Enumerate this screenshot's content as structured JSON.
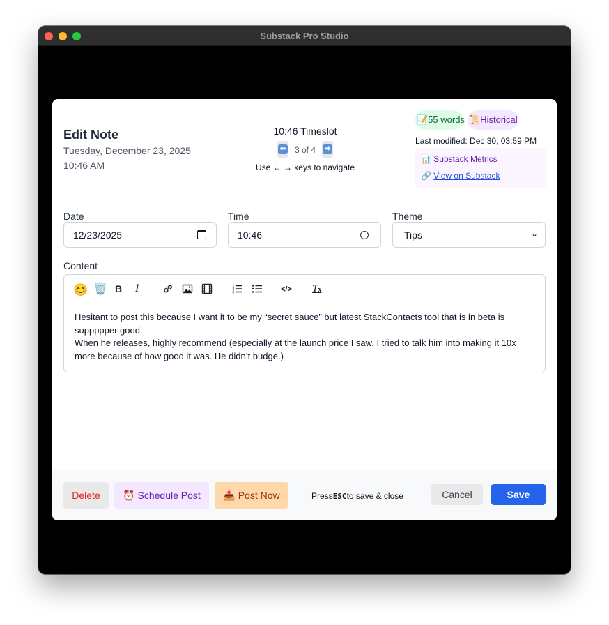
{
  "window": {
    "title": "Substack Pro Studio"
  },
  "header": {
    "title": "Edit Note",
    "date": "Tuesday, December 23, 2025",
    "time": "10:46 AM"
  },
  "navigator": {
    "slot_title": "10:46 Timeslot",
    "prev_icon": "⬅",
    "next_icon": "➡",
    "count": "3 of 4",
    "hint": "Use ← → keys to navigate"
  },
  "meta": {
    "words_badge": "📝55 words",
    "history_badge": "📜Historical",
    "last_modified": "Last modified: Dec 30, 03:59 PM",
    "metrics_label": "📊 Substack Metrics",
    "view_icon": "🔗",
    "view_label": "View on Substack"
  },
  "form": {
    "date_label": "Date",
    "date_value": "12/23/2025",
    "time_label": "Time",
    "time_value": "10:46",
    "theme_label": "Theme",
    "theme_value": "Tips",
    "content_label": "Content"
  },
  "toolbar": {
    "emoji": "😊",
    "trash": "🗑️",
    "bold": "B",
    "italic": "I",
    "code": "</>",
    "clear": "T",
    "clear_sub": "x"
  },
  "content": {
    "paragraph_1": "Hesitant to post this because I want it to be my “secret sauce” but  latest StackContacts tool that is in beta is suppppper good.",
    "paragraph_2": "When he releases, highly recommend (especially at the launch price I saw. I tried to talk him into making it 10x more because of how good it was.  He didn’t budge.)"
  },
  "footer": {
    "delete_label": "Delete",
    "schedule_label": "⏰ Schedule Post",
    "post_label": "📤 Post Now",
    "hint_press": "Press",
    "hint_key": "ESC",
    "hint_rest": "to save & close",
    "cancel_label": "Cancel",
    "save_label": "Save"
  },
  "colors": {
    "accent": "#2563eb",
    "danger": "#dc2626",
    "purple": "#6b21a8",
    "green": "#166534"
  }
}
